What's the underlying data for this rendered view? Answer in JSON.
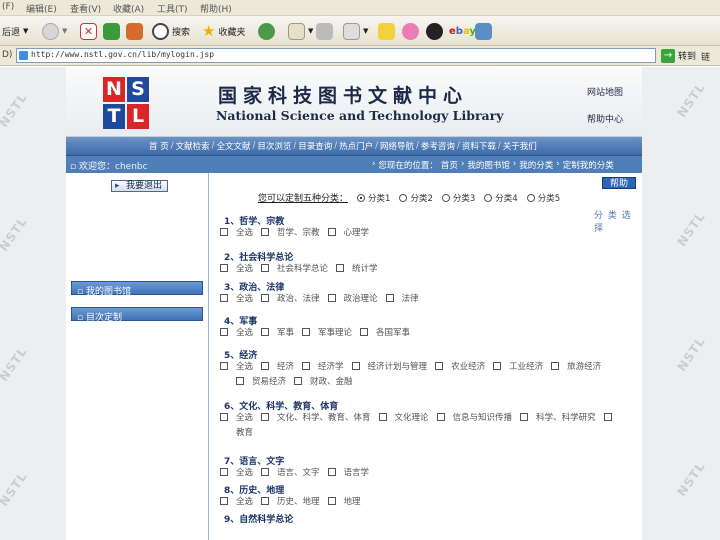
{
  "browser": {
    "menu": [
      "(F)",
      "编辑(E)",
      "查看(V)",
      "收藏(A)",
      "工具(T)",
      "帮助(H)"
    ],
    "toolbar": {
      "back_label": "后退",
      "search_label": "搜索",
      "favorites_label": "收藏夹"
    },
    "address": {
      "label": "D)",
      "url": "http://www.nstl.gov.cn/lib/mylogin.jsp",
      "go_label": "转到",
      "links_label": "链"
    }
  },
  "watermark_text": "NSTL",
  "site": {
    "logo": {
      "letters": [
        "N",
        "S",
        "T",
        "L"
      ]
    },
    "title_cn": "国家科技图书文献中心",
    "title_en": "National Science and Technology Library",
    "header_links": [
      "网站地图",
      "帮助中心"
    ],
    "nav_items": [
      "首 页",
      "文献检索",
      "全文文献",
      "目次浏览",
      "目录查询",
      "热点门户",
      "网络导航",
      "参考咨询",
      "资料下载",
      "关于我们"
    ],
    "welcome_label": "欢迎您：",
    "welcome_user": "chenbc",
    "breadcrumb": [
      "您现在的位置：",
      "首页",
      "我的图书馆",
      "我的分类",
      "定制我的分类"
    ],
    "logout_label": "我要退出",
    "sidebar_items": [
      "我的图书馆",
      "目次定制"
    ],
    "help_label": "帮助",
    "choose_prefix": "您可以定制五种分类：",
    "radio_options": [
      "分类1",
      "分类2",
      "分类3",
      "分类4",
      "分类5"
    ],
    "radio_selected": 0,
    "category_heading": "分 类 选 择"
  },
  "groups": [
    {
      "title": "1、哲学、宗教",
      "rows": [
        [
          "全选",
          "哲学、宗教",
          "心理学"
        ]
      ]
    },
    {
      "title": "2、社会科学总论",
      "rows": [
        [
          "全选",
          "社会科学总论",
          "统计学"
        ]
      ]
    },
    {
      "title": "3、政治、法律",
      "rows": [
        [
          "全选",
          "政治、法律",
          "政治理论",
          "法律"
        ]
      ]
    },
    {
      "title": "4、军事",
      "rows": [
        [
          "全选",
          "军事",
          "军事理论",
          "各国军事"
        ]
      ]
    },
    {
      "title": "5、经济",
      "rows": [
        [
          "全选",
          "经济",
          "经济学",
          "经济计划与管理",
          "农业经济",
          "工业经济",
          "旅游经济"
        ],
        [
          "贸易经济",
          "财政、金融"
        ]
      ]
    },
    {
      "title": "6、文化、科学、教育、体育",
      "rows": [
        [
          "全选",
          "文化、科学、教育、体育",
          "文化理论",
          "信息与知识传播",
          "科学、科学研究",
          ""
        ],
        [
          "教育"
        ]
      ]
    },
    {
      "title": "7、语言、文字",
      "rows": [
        [
          "全选",
          "语言、文字",
          "语言学"
        ]
      ]
    },
    {
      "title": "8、历史、地理",
      "rows": [
        [
          "全选",
          "历史、地理",
          "地理"
        ]
      ]
    },
    {
      "title": "9、自然科学总论",
      "rows": []
    }
  ]
}
